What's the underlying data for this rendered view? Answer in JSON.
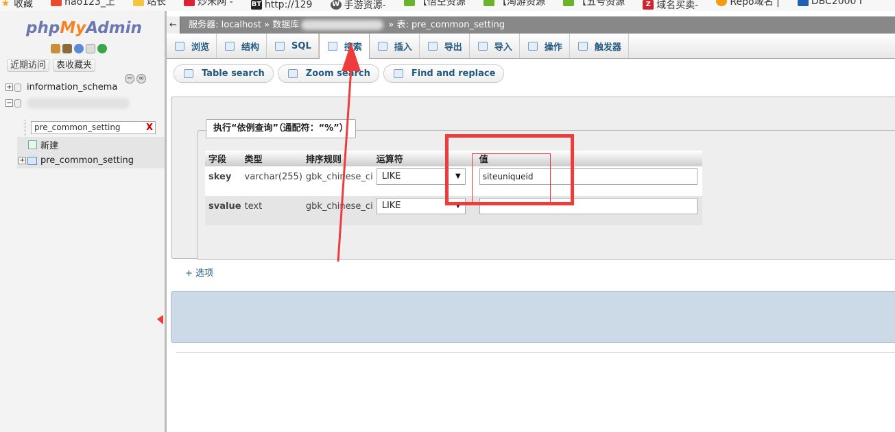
{
  "bookmarks": [
    {
      "label": "收藏",
      "icon": "star-icon"
    },
    {
      "label": "hao123_上",
      "icon": "hao123-icon"
    },
    {
      "label": "站长",
      "icon": "folder-icon"
    },
    {
      "label": "炒米网 -",
      "icon": "chart-icon"
    },
    {
      "label": "http://129",
      "icon": "bt-icon"
    },
    {
      "label": "手游资源-",
      "icon": "wordpress-icon"
    },
    {
      "label": "【悟空资源",
      "icon": "wechat-icon"
    },
    {
      "label": "【淘游资源",
      "icon": "wechat-icon"
    },
    {
      "label": "【五号资源",
      "icon": "wechat-icon"
    },
    {
      "label": "域名买卖-",
      "icon": "z-icon"
    },
    {
      "label": "Repo域名 |",
      "icon": "repo-icon"
    },
    {
      "label": "DBC2000 I",
      "icon": "dbc-icon"
    }
  ],
  "nav": {
    "logo": {
      "php": "php",
      "my": "My",
      "admin": "Admin"
    },
    "tabs": [
      "近期访问",
      "表收藏夹"
    ],
    "databases": [
      {
        "name": "information_schema",
        "expander": "+"
      },
      {
        "name": "",
        "expander": "−"
      }
    ],
    "filter_value": "pre_common_setting",
    "filter_clear": "X",
    "new_label": "新建",
    "table_name": "pre_common_setting",
    "collapse_symbol": "−",
    "link_symbol": "∞"
  },
  "breadcrumb": {
    "back": "←",
    "server": "服务器: localhost",
    "sep1": "»",
    "database": "数据库",
    "sep2": "»",
    "table": "表: pre_common_setting"
  },
  "tabs": [
    {
      "label": "浏览",
      "icon": "browse-icon"
    },
    {
      "label": "结构",
      "icon": "structure-icon"
    },
    {
      "label": "SQL",
      "icon": "sql-icon"
    },
    {
      "label": "搜索",
      "icon": "search-icon",
      "active": true
    },
    {
      "label": "插入",
      "icon": "insert-icon"
    },
    {
      "label": "导出",
      "icon": "export-icon"
    },
    {
      "label": "导入",
      "icon": "import-icon"
    },
    {
      "label": "操作",
      "icon": "wrench-icon"
    },
    {
      "label": "触发器",
      "icon": "trigger-icon"
    }
  ],
  "subtabs": [
    {
      "label": "Table search",
      "icon": "search-icon"
    },
    {
      "label": "Zoom search",
      "icon": "zoom-icon"
    },
    {
      "label": "Find and replace",
      "icon": "replace-icon"
    }
  ],
  "query": {
    "legend": "执行“依例查询”（通配符：“%”）",
    "headers": [
      "字段",
      "类型",
      "排序规则",
      "运算符",
      "值"
    ],
    "rows": [
      {
        "field": "skey",
        "type": "varchar(255)",
        "collation": "gbk_chinese_ci",
        "operator": "LIKE",
        "value": "siteuniqueid"
      },
      {
        "field": "svalue",
        "type": "text",
        "collation": "gbk_chinese_ci",
        "operator": "LIKE",
        "value": ""
      }
    ],
    "dropdown_arrow": "▼"
  },
  "options_link": "+ 选项",
  "colors": {
    "annotation": "#ee3b3b",
    "link": "#235a81"
  }
}
